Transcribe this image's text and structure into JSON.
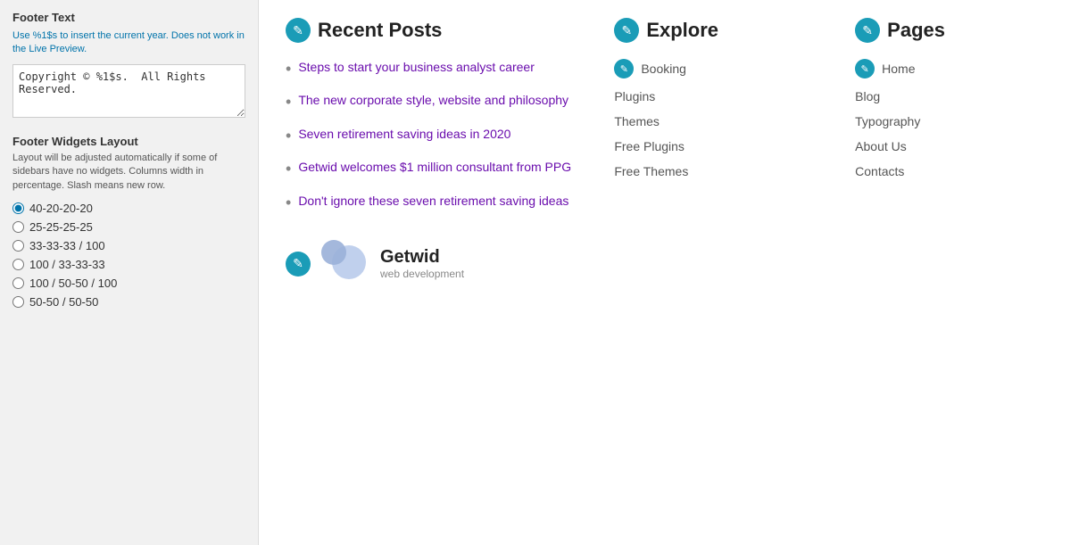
{
  "leftPanel": {
    "footerTextLabel": "Footer Text",
    "footerTextHint": "Use %1$s to insert the current year. Does not work in the Live Preview.",
    "footerTextValue": "Copyright © %1$s.  All Rights Reserved.",
    "footerWidgetsLabel": "Footer Widgets Layout",
    "footerWidgetsHint": "Layout will be adjusted automatically if some of sidebars have no widgets. Columns width in percentage. Slash means new row.",
    "layoutOptions": [
      {
        "value": "40-20-20-20",
        "label": "40-20-20-20",
        "checked": true
      },
      {
        "value": "25-25-25-25",
        "label": "25-25-25-25",
        "checked": false
      },
      {
        "value": "33-33-33/100",
        "label": "33-33-33 / 100",
        "checked": false
      },
      {
        "value": "100/33-33-33",
        "label": "100 / 33-33-33",
        "checked": false
      },
      {
        "value": "100/50-50/100",
        "label": "100 / 50-50 / 100",
        "checked": false
      },
      {
        "value": "50-50/50-50",
        "label": "50-50 / 50-50",
        "checked": false
      }
    ]
  },
  "rightPanel": {
    "recentPosts": {
      "title": "Recent Posts",
      "items": [
        "Steps to start your business analyst career",
        "The new corporate style, website and philosophy",
        "Seven retirement saving ideas in 2020",
        "Getwid welcomes $1 million consultant from PPG",
        "Don't ignore these seven retirement saving ideas"
      ]
    },
    "explore": {
      "title": "Explore",
      "items": [
        {
          "label": "Booking",
          "hasIcon": true
        },
        {
          "label": "Plugins",
          "hasIcon": false
        },
        {
          "label": "Themes",
          "hasIcon": false
        },
        {
          "label": "Free Plugins",
          "hasIcon": false
        },
        {
          "label": "Free Themes",
          "hasIcon": false
        }
      ]
    },
    "pages": {
      "title": "Pages",
      "items": [
        {
          "label": "Home",
          "hasIcon": true
        },
        {
          "label": "Blog",
          "hasIcon": false
        },
        {
          "label": "Typography",
          "hasIcon": false
        },
        {
          "label": "About Us",
          "hasIcon": false
        },
        {
          "label": "Contacts",
          "hasIcon": false
        }
      ]
    },
    "brand": {
      "name": "Getwid",
      "subtitle": "web development"
    }
  }
}
